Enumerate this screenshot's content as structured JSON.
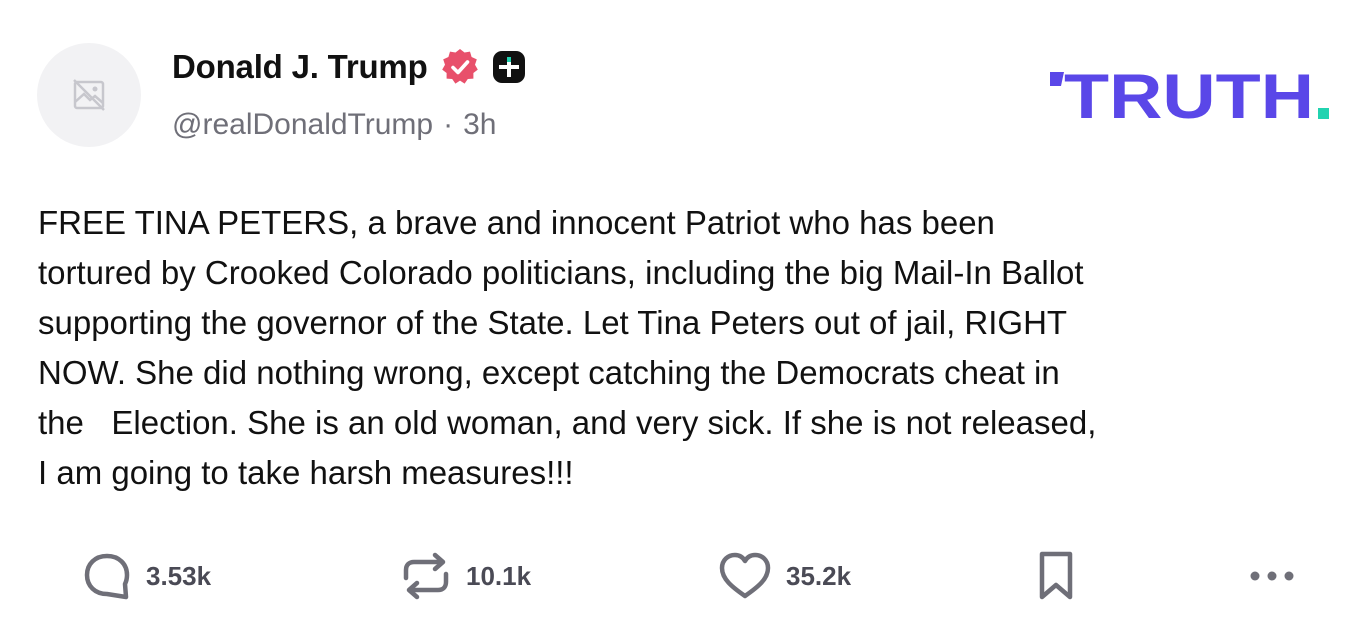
{
  "post": {
    "author": {
      "name": "Donald J. Trump",
      "handle": "@realDonaldTrump",
      "separator": "·",
      "time": "3h",
      "avatar_icon": "broken-image-icon",
      "verified_icon": "verified-badge-icon",
      "badge_icon": "plus-badge-icon"
    },
    "brand": {
      "logo_text": "TRUTH",
      "logo_dot": ".",
      "logo_color": "#5a47e8",
      "logo_dot_color": "#21d3b0"
    },
    "text": "FREE TINA PETERS, a brave and innocent Patriot who has been\ntortured by Crooked Colorado politicians, including the big Mail-In Ballot\nsupporting the governor of the State. Let Tina Peters out of jail, RIGHT\nNOW. She did nothing wrong, except catching the Democrats cheat in\nthe   Election. She is an old woman, and very sick. If she is not released,\nI am going to take harsh measures!!!",
    "actions": {
      "reply": {
        "icon": "reply-icon",
        "count": "3.53k"
      },
      "retruth": {
        "icon": "repost-icon",
        "count": "10.1k"
      },
      "like": {
        "icon": "heart-icon",
        "count": "35.2k"
      },
      "bookmark": {
        "icon": "bookmark-icon"
      },
      "more": {
        "icon": "more-icon"
      }
    },
    "colors": {
      "verified": "#e8506b",
      "icon_gray": "#6f6f78",
      "text": "#111111",
      "muted": "#6f6f78"
    }
  }
}
